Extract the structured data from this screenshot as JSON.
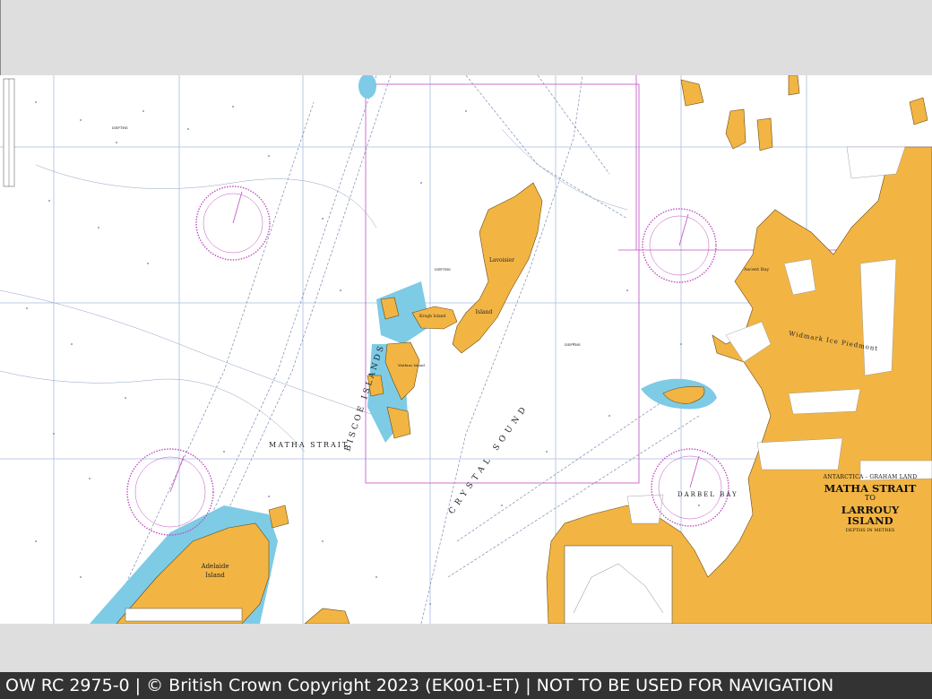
{
  "footer": {
    "text": "OW RC 2975-0 | © British Crown Copyright 2023 (EK001-ET) | NOT TO BE USED FOR NAVIGATION"
  },
  "title_panel": {
    "region": "ANTARCTICA - GRAHAM LAND",
    "title_line1": "MATHA STRAIT",
    "title_to": "TO",
    "title_line2": "LARROUY ISLAND",
    "subtitle": "DEPTHS IN METRES"
  },
  "labels": {
    "matha_strait": "MATHA  STRAIT",
    "biscoe_islands": "BISCOE   ISLANDS",
    "crystal_sound": "CRYSTAL   SOUND",
    "darbel_bay": "DARBEL   BAY",
    "lavoisier": "Lavoisier",
    "island": "Island",
    "adelaide": "Adelaide",
    "adelaide_island": "Island",
    "krogh_island": "Krogh Island",
    "watkins_island": "Watkins Island",
    "ascent_bay": "Ascent Bay",
    "widmark_ice_piedmont": "Widmark  Ice  Piedmont",
    "depths": "DEPTHS"
  },
  "colors": {
    "land": "#f2b544",
    "shallow_water": "#7ecbe6",
    "deep_water": "#ffffff",
    "grid": "#a9bde0",
    "magenta": "#c04fc0",
    "depth_contour": "#7a8db0"
  },
  "compass_roses": [
    "compass-rose",
    "compass-rose",
    "compass-rose",
    "compass-rose"
  ]
}
